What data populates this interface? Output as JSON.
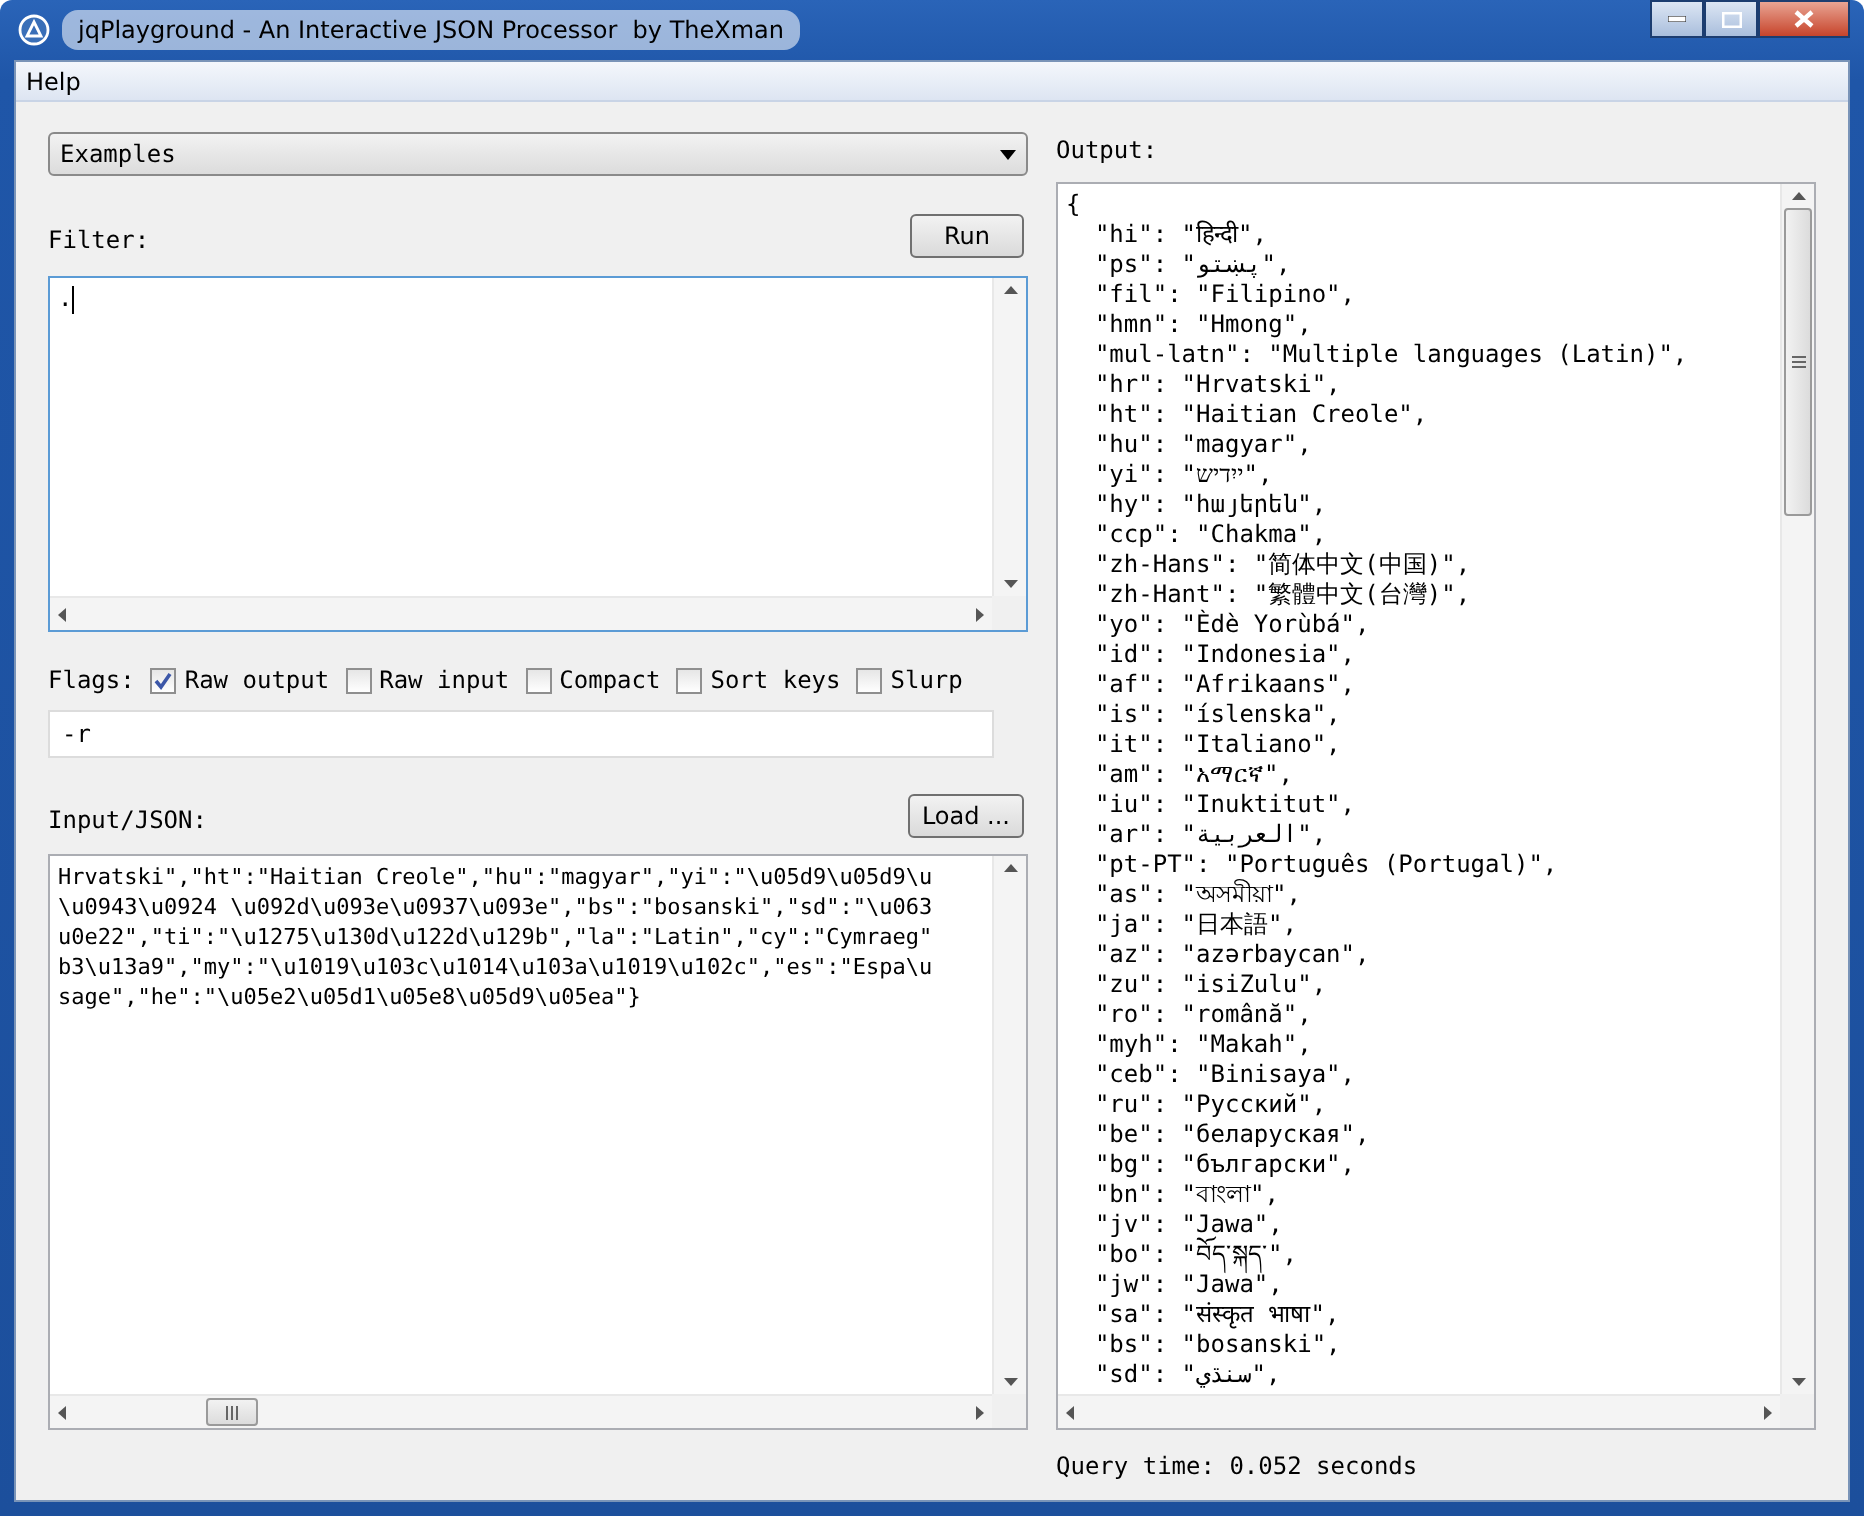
{
  "window": {
    "title": "jqPlayground - An Interactive JSON Processor  by TheXman"
  },
  "menu_bar": [
    {
      "label": "Help"
    }
  ],
  "examples_dropdown": {
    "value": "Examples"
  },
  "filter": {
    "label": "Filter:",
    "run_button": "Run",
    "value": "."
  },
  "flags": {
    "label": "Flags:",
    "options": [
      {
        "label": "Raw output",
        "checked": true
      },
      {
        "label": "Raw input",
        "checked": false
      },
      {
        "label": "Compact",
        "checked": false
      },
      {
        "label": "Sort keys",
        "checked": false
      },
      {
        "label": "Slurp",
        "checked": false
      }
    ],
    "value": "-r"
  },
  "input": {
    "label": "Input/JSON:",
    "load_button": "Load ...",
    "lines": [
      "Hrvatski\",\"ht\":\"Haitian Creole\",\"hu\":\"magyar\",\"yi\":\"\\u05d9\\u05d9\\u",
      "\\u0943\\u0924 \\u092d\\u093e\\u0937\\u093e\",\"bs\":\"bosanski\",\"sd\":\"\\u063",
      "u0e22\",\"ti\":\"\\u1275\\u130d\\u122d\\u129b\",\"la\":\"Latin\",\"cy\":\"Cymraeg\"",
      "b3\\u13a9\",\"my\":\"\\u1019\\u103c\\u1014\\u103a\\u1019\\u102c\",\"es\":\"Espa\\u",
      "sage\",\"he\":\"\\u05e2\\u05d1\\u05e8\\u05d9\\u05ea\"}"
    ]
  },
  "output": {
    "label": "Output:",
    "lines": [
      "{",
      "  \"hi\": \"हिन्दी\",",
      "  \"ps\": \"پښتو\",",
      "  \"fil\": \"Filipino\",",
      "  \"hmn\": \"Hmong\",",
      "  \"mul-latn\": \"Multiple languages (Latin)\",",
      "  \"hr\": \"Hrvatski\",",
      "  \"ht\": \"Haitian Creole\",",
      "  \"hu\": \"magyar\",",
      "  \"yi\": \"ייִדיש\",",
      "  \"hy\": \"հայերեն\",",
      "  \"ccp\": \"Chakma\",",
      "  \"zh-Hans\": \"简体中文(中国)\",",
      "  \"zh-Hant\": \"繁體中文(台灣)\",",
      "  \"yo\": \"Èdè Yorùbá\",",
      "  \"id\": \"Indonesia\",",
      "  \"af\": \"Afrikaans\",",
      "  \"is\": \"íslenska\",",
      "  \"it\": \"Italiano\",",
      "  \"am\": \"አማርኛ\",",
      "  \"iu\": \"Inuktitut\",",
      "  \"ar\": \"العربية\",",
      "  \"pt-PT\": \"Português (Portugal)\",",
      "  \"as\": \"অসমীয়া\",",
      "  \"ja\": \"日本語\",",
      "  \"az\": \"azərbaycan\",",
      "  \"zu\": \"isiZulu\",",
      "  \"ro\": \"română\",",
      "  \"myh\": \"Makah\",",
      "  \"ceb\": \"Binisaya\",",
      "  \"ru\": \"Русский\",",
      "  \"be\": \"беларуская\",",
      "  \"bg\": \"български\",",
      "  \"bn\": \"বাংলা\",",
      "  \"jv\": \"Jawa\",",
      "  \"bo\": \"བོད་སྐད་\",",
      "  \"jw\": \"Jawa\",",
      "  \"sa\": \"संस्कृत भाषा\",",
      "  \"bs\": \"bosanski\",",
      "  \"sd\": \"سنڌي\","
    ]
  },
  "status": "Query time: 0.052 seconds"
}
